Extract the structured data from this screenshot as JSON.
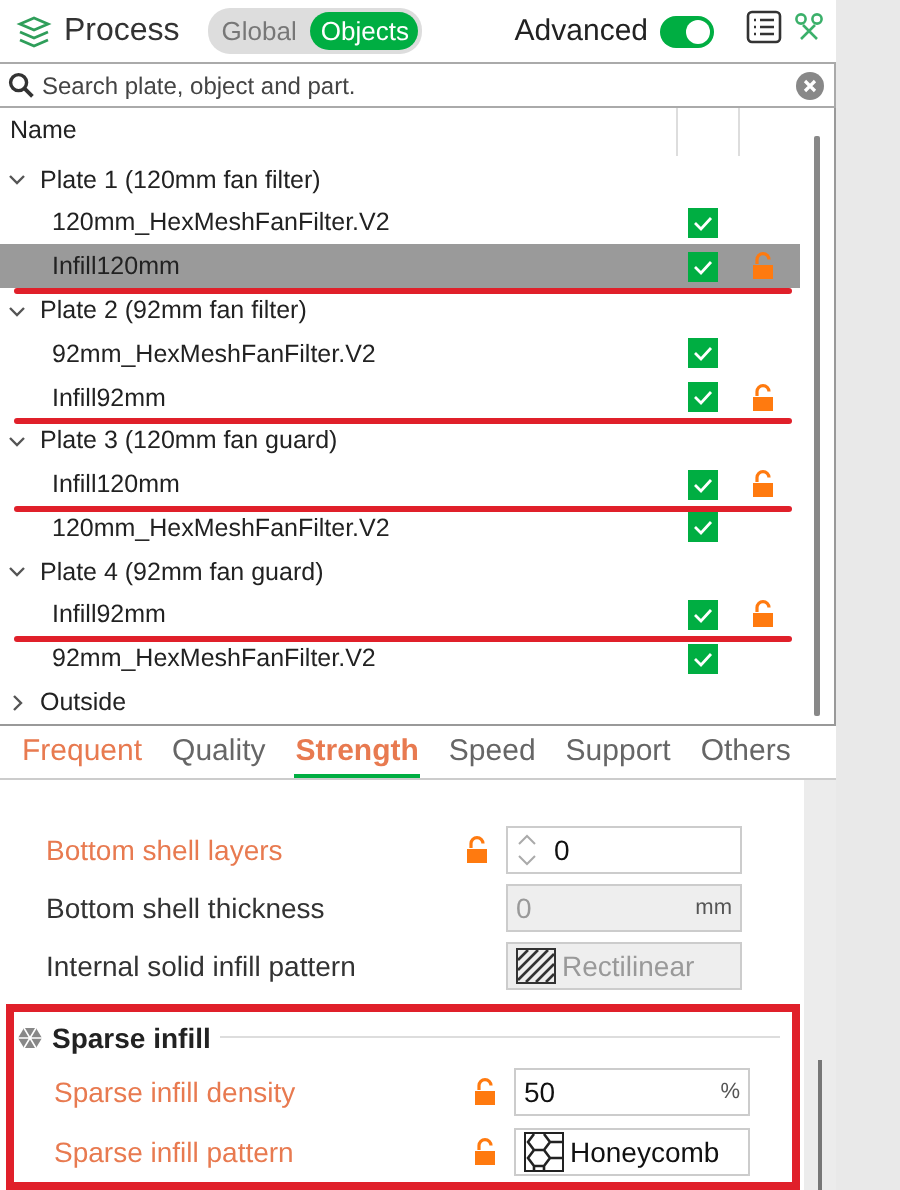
{
  "header": {
    "title": "Process",
    "scope_options": [
      {
        "label": "Global",
        "selected": false
      },
      {
        "label": "Objects",
        "selected": true
      }
    ],
    "advanced": {
      "label": "Advanced",
      "on": true
    }
  },
  "search": {
    "placeholder": "Search plate, object and part."
  },
  "tree": {
    "column_name": "Name",
    "items": [
      {
        "label": "Plate 1 (120mm fan filter)",
        "expanded": true,
        "children": [
          {
            "label": "120mm_HexMeshFanFilter.V2",
            "checked": true,
            "lock": false,
            "selected": false,
            "underlined": false
          },
          {
            "label": "Infill120mm",
            "checked": true,
            "lock": true,
            "selected": true,
            "underlined": true
          }
        ]
      },
      {
        "label": "Plate 2 (92mm fan filter)",
        "expanded": true,
        "children": [
          {
            "label": "92mm_HexMeshFanFilter.V2",
            "checked": true,
            "lock": false,
            "selected": false,
            "underlined": false
          },
          {
            "label": "Infill92mm",
            "checked": true,
            "lock": true,
            "selected": false,
            "underlined": true
          }
        ]
      },
      {
        "label": "Plate 3 (120mm fan guard)",
        "expanded": true,
        "children": [
          {
            "label": "Infill120mm",
            "checked": true,
            "lock": true,
            "selected": false,
            "underlined": true
          },
          {
            "label": "120mm_HexMeshFanFilter.V2",
            "checked": true,
            "lock": false,
            "selected": false,
            "underlined": false
          }
        ]
      },
      {
        "label": "Plate 4 (92mm fan guard)",
        "expanded": true,
        "children": [
          {
            "label": "Infill92mm",
            "checked": true,
            "lock": true,
            "selected": false,
            "underlined": true
          },
          {
            "label": "92mm_HexMeshFanFilter.V2",
            "checked": true,
            "lock": false,
            "selected": false,
            "underlined": false
          }
        ]
      },
      {
        "label": "Outside",
        "expanded": false
      }
    ]
  },
  "tabs": [
    {
      "label": "Frequent",
      "selected": false,
      "modified": true
    },
    {
      "label": "Quality",
      "selected": false,
      "modified": false
    },
    {
      "label": "Strength",
      "selected": true,
      "modified": true
    },
    {
      "label": "Speed",
      "selected": false,
      "modified": false
    },
    {
      "label": "Support",
      "selected": false,
      "modified": false
    },
    {
      "label": "Others",
      "selected": false,
      "modified": false
    }
  ],
  "settings": [
    {
      "kind": "spin",
      "label": "Bottom shell layers",
      "modified": true,
      "disabled": false,
      "value": "0"
    },
    {
      "kind": "number",
      "label": "Bottom shell thickness",
      "modified": false,
      "disabled": true,
      "value": "0",
      "unit": "mm"
    },
    {
      "kind": "hatch",
      "label": "Internal solid infill pattern",
      "modified": false,
      "disabled": true,
      "value": "Rectilinear"
    },
    {
      "kind": "group",
      "label": "Sparse infill",
      "highlighted": true,
      "options": [
        {
          "kind": "number",
          "label": "Sparse infill density",
          "modified": true,
          "disabled": false,
          "value": "50",
          "unit": "%"
        },
        {
          "kind": "honeycomb",
          "label": "Sparse infill pattern",
          "modified": true,
          "disabled": false,
          "value": "Honeycomb"
        }
      ]
    }
  ]
}
